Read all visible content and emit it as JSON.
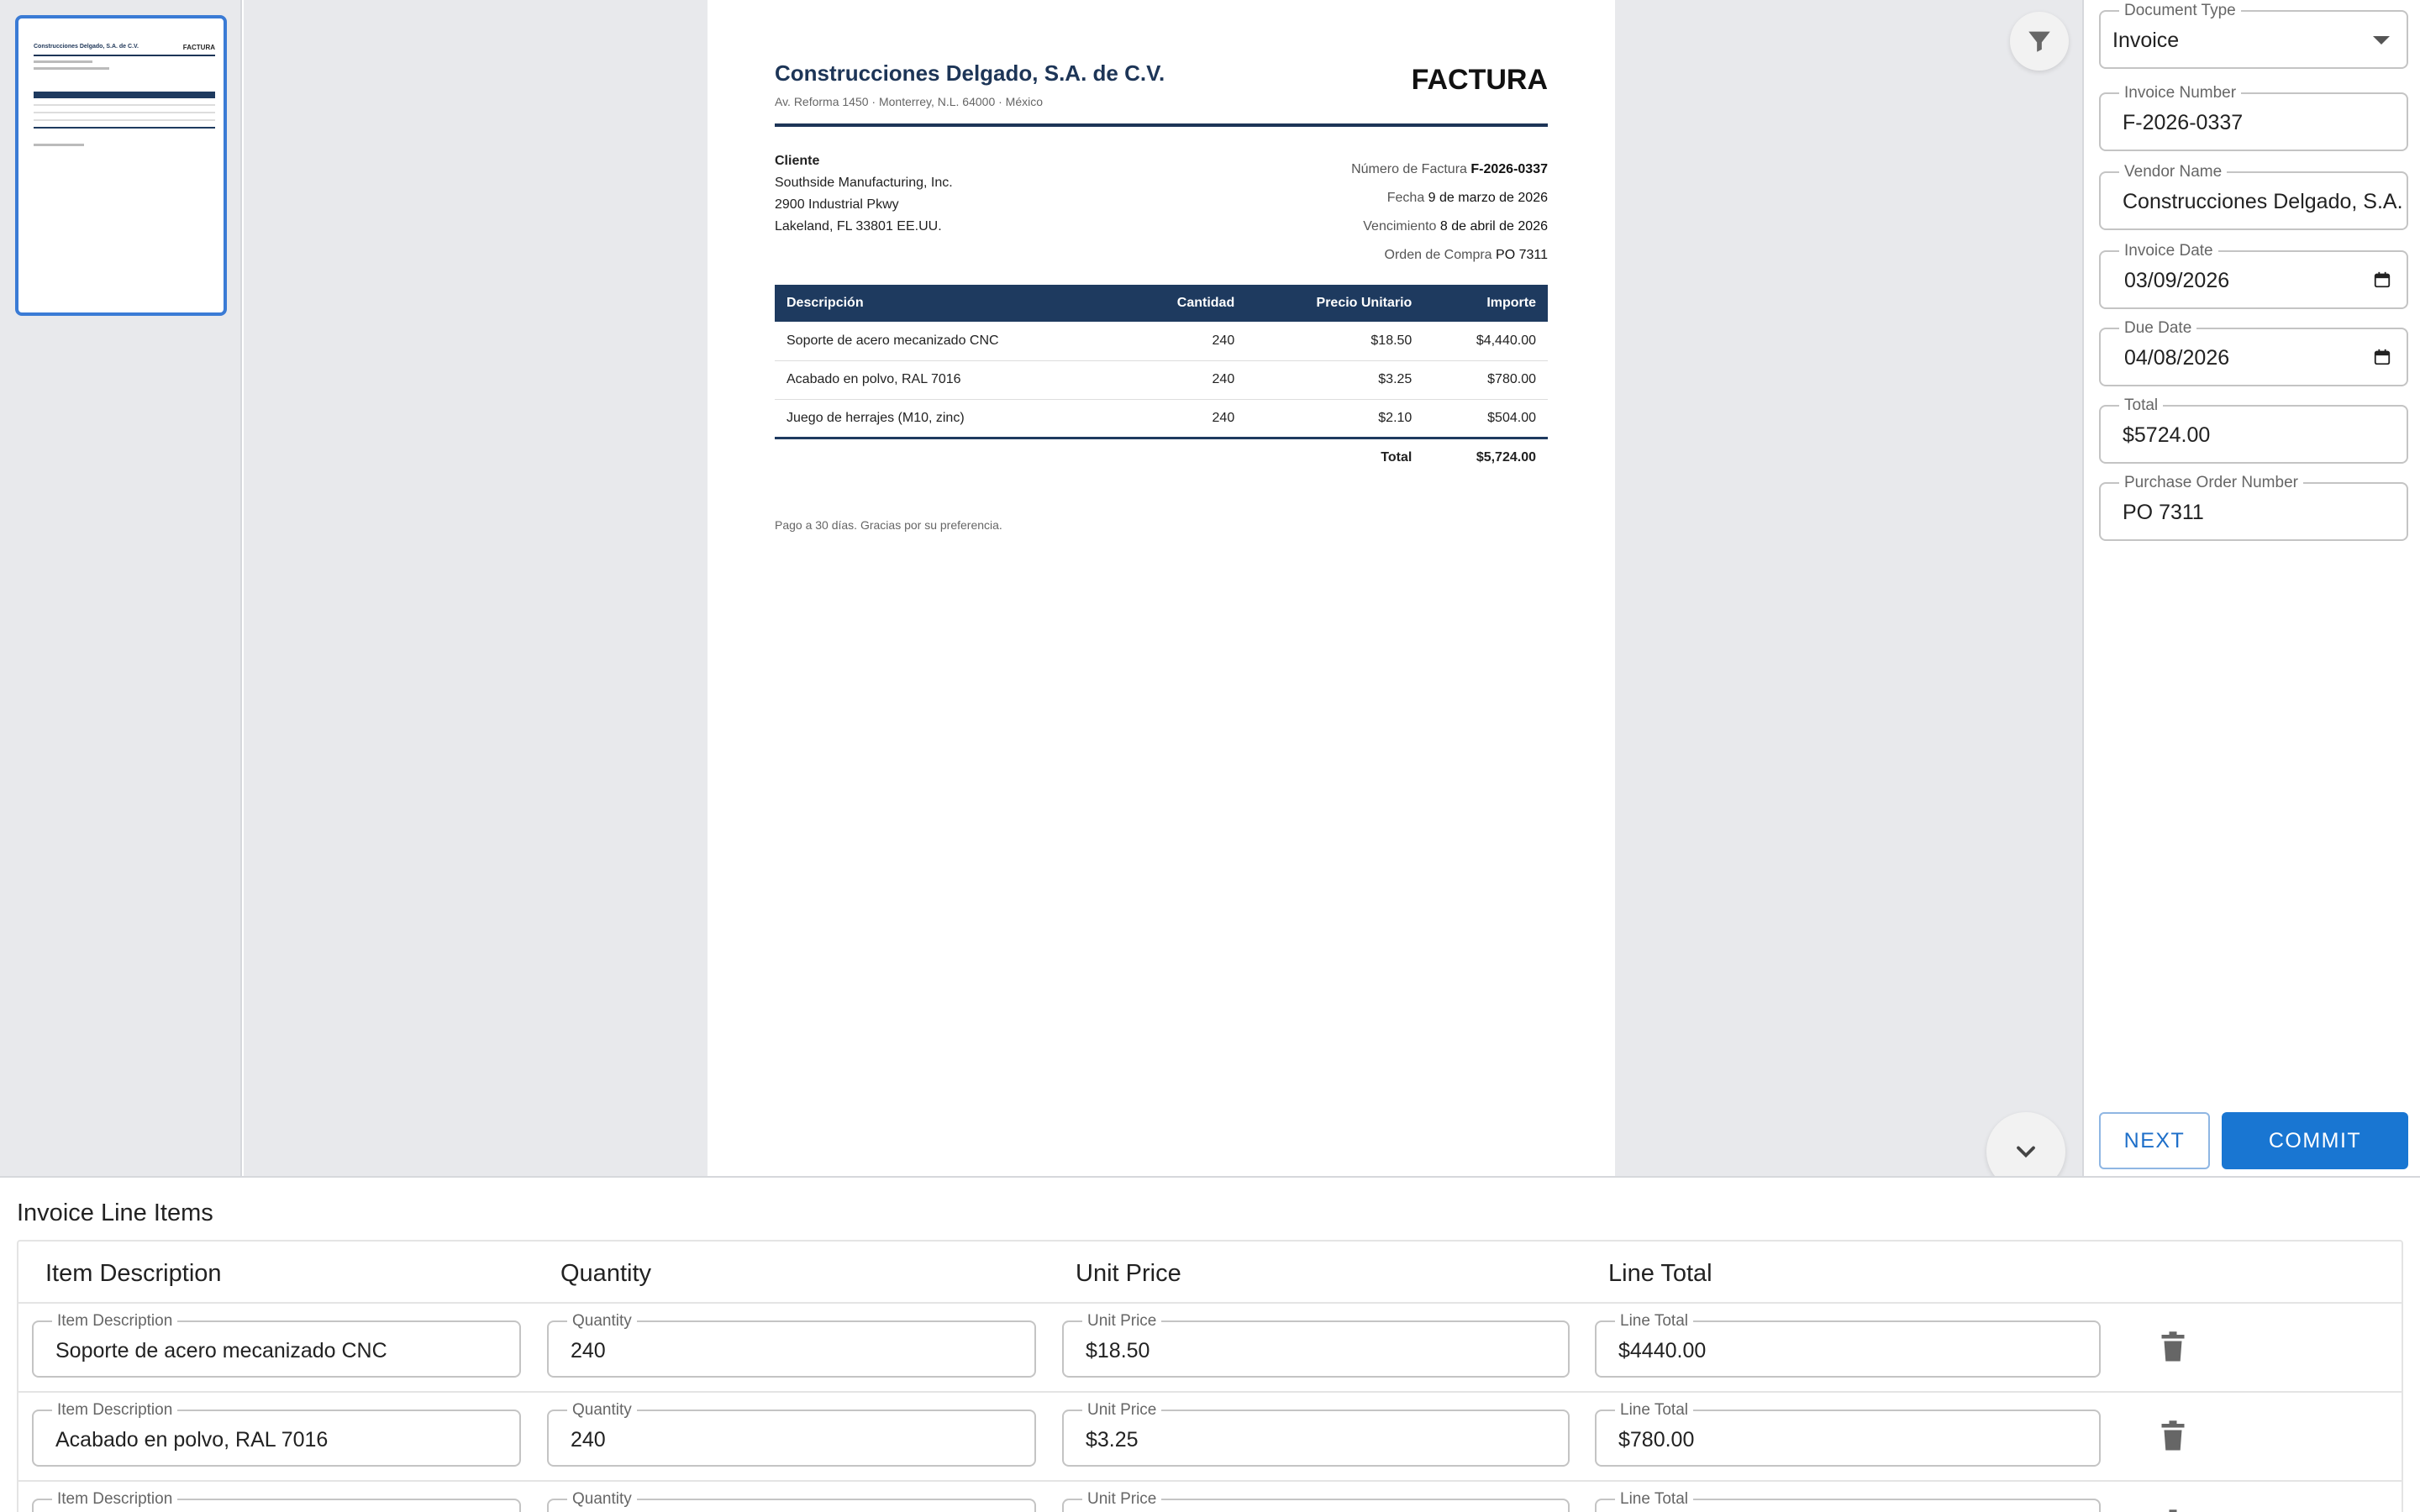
{
  "thumbnail": {
    "label": "page-1"
  },
  "document": {
    "company": "Construcciones Delgado, S.A. de C.V.",
    "address": "Av. Reforma 1450 · Monterrey, N.L. 64000 · México",
    "doc_title": "FACTURA",
    "client_label": "Cliente",
    "client_name": "Southside Manufacturing, Inc.",
    "client_street": "2900 Industrial Pkwy",
    "client_city": "Lakeland, FL 33801 EE.UU.",
    "meta": [
      {
        "key": "Número de Factura",
        "value": "F-2026-0337",
        "bold": true
      },
      {
        "key": "Fecha",
        "value": "9 de marzo de 2026",
        "bold": false
      },
      {
        "key": "Vencimiento",
        "value": "8 de abril de 2026",
        "bold": false
      },
      {
        "key": "Orden de Compra",
        "value": "PO 7311",
        "bold": false
      }
    ],
    "table_headers": [
      "Descripción",
      "Cantidad",
      "Precio Unitario",
      "Importe"
    ],
    "rows": [
      [
        "Soporte de acero mecanizado CNC",
        "240",
        "$18.50",
        "$4,440.00"
      ],
      [
        "Acabado en polvo, RAL 7016",
        "240",
        "$3.25",
        "$780.00"
      ],
      [
        "Juego de herrajes (M10, zinc)",
        "240",
        "$2.10",
        "$504.00"
      ]
    ],
    "total_label": "Total",
    "total_value": "$5,724.00",
    "footer": "Pago a 30 días. Gracias por su preferencia."
  },
  "form": {
    "document_type": {
      "label": "Document Type",
      "value": "Invoice"
    },
    "invoice_number": {
      "label": "Invoice Number",
      "value": "F-2026-0337"
    },
    "vendor_name": {
      "label": "Vendor Name",
      "value": "Construcciones Delgado, S.A. de C.V."
    },
    "invoice_date": {
      "label": "Invoice Date",
      "value": "03/09/2026"
    },
    "due_date": {
      "label": "Due Date",
      "value": "04/08/2026"
    },
    "total": {
      "label": "Total",
      "value": "$5724.00"
    },
    "po_number": {
      "label": "Purchase Order Number",
      "value": "PO 7311"
    },
    "next_label": "NEXT",
    "commit_label": "COMMIT"
  },
  "line_items": {
    "title": "Invoice Line Items",
    "headers": [
      "Item Description",
      "Quantity",
      "Unit Price",
      "Line Total"
    ],
    "field_labels": {
      "description": "Item Description",
      "quantity": "Quantity",
      "unit_price": "Unit Price",
      "line_total": "Line Total"
    },
    "rows": [
      {
        "description": "Soporte de acero mecanizado CNC",
        "quantity": "240",
        "unit_price": "$18.50",
        "line_total": "$4440.00"
      },
      {
        "description": "Acabado en polvo, RAL 7016",
        "quantity": "240",
        "unit_price": "$3.25",
        "line_total": "$780.00"
      },
      {
        "description": "",
        "quantity": "",
        "unit_price": "",
        "line_total": ""
      }
    ]
  },
  "icons": {
    "filter": "filter-icon",
    "expand": "chevron-down-icon",
    "dropdown": "caret-down-icon",
    "calendar": "calendar-icon",
    "delete": "trash-icon"
  },
  "colors": {
    "brand_navy": "#1e3a5f",
    "accent_blue": "#1976d2",
    "selected_thumb": "#3a7bd5"
  }
}
